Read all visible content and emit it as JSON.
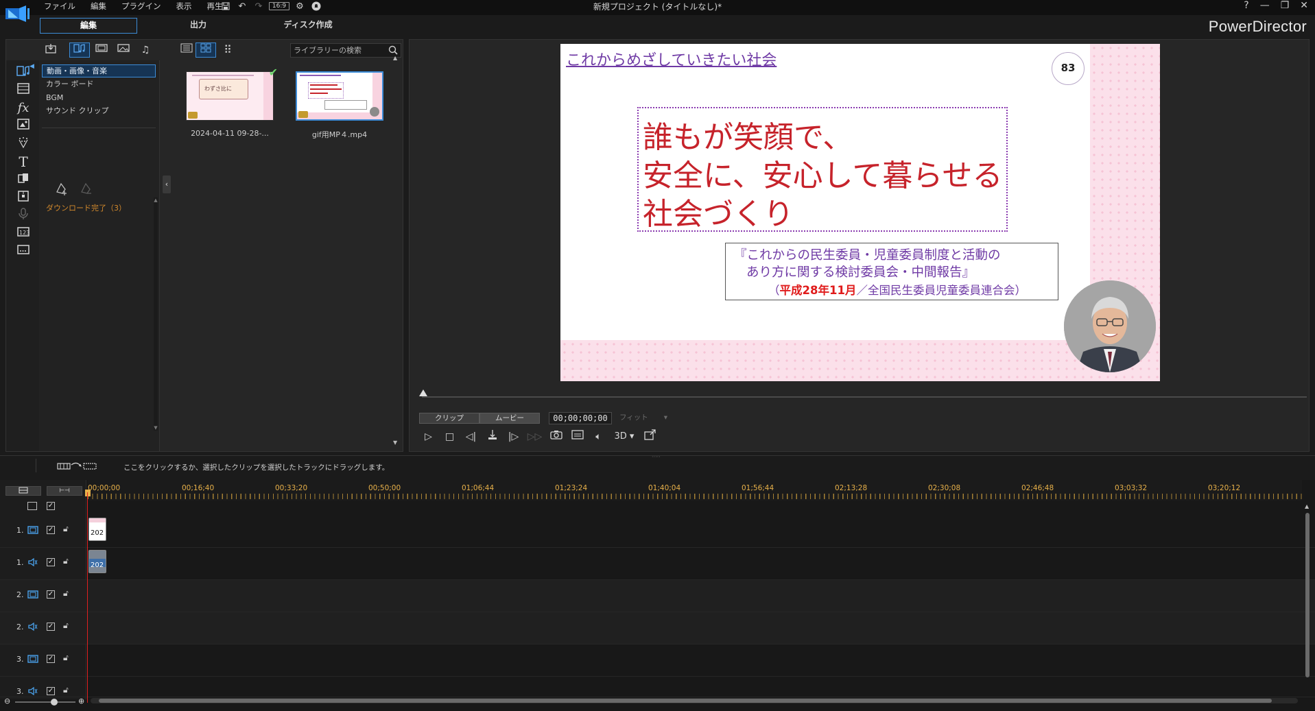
{
  "app": {
    "window_title": "新規プロジェクト (タイトルなし)*",
    "brand": "PowerDirector",
    "menu": [
      "ファイル",
      "編集",
      "プラグイン",
      "表示",
      "再生"
    ],
    "aspect_ratio": "16:9",
    "mode_tabs": [
      "編集",
      "出力",
      "ディスク作成"
    ],
    "window_controls": [
      "?",
      "—",
      "❐",
      "✕"
    ]
  },
  "library": {
    "search_placeholder": "ライブラリーの検索",
    "tree": [
      "動画・画像・音楽",
      "カラー ボード",
      "BGM",
      "サウンド クリップ"
    ],
    "download_done": "ダウンロード完了（3）",
    "media": [
      {
        "label": "2024-04-11 09-28-...",
        "thumb_text": "わずさ比に"
      },
      {
        "label": "gif用MP４.mp4"
      }
    ]
  },
  "preview": {
    "slide": {
      "heading": "これからめざしていきたい社会",
      "number": "83",
      "main_lines": [
        "誰もが笑顔で、",
        "安全に、安心して暮らせる",
        "社会づくり"
      ],
      "quote_line1": "『これからの民生委員・児童委員制度と活動の",
      "quote_line2": "あり方に関する検討委員会・中間報告』",
      "quote_line3_pre": "（",
      "quote_line3_red": "平成28年11月",
      "quote_line3_post": "／全国民生委員児童委員連合会）"
    },
    "mode_clip": "クリップ",
    "mode_movie": "ムービー",
    "timecode": "00;00;00;00",
    "fit": "フィット",
    "threed": "3D"
  },
  "timeline": {
    "hint": "ここをクリックするか、選択したクリップを選択したトラックにドラッグします。",
    "ruler_labels": [
      "00;00;00",
      "00;16;40",
      "00;33;20",
      "00;50;00",
      "01;06;44",
      "01;23;24",
      "01;40;04",
      "01;56;44",
      "02;13;28",
      "02;30;08",
      "02;46;48",
      "03;03;32",
      "03;20;12"
    ],
    "tracks": [
      {
        "num": "1.",
        "type": "video"
      },
      {
        "num": "1.",
        "type": "audio"
      },
      {
        "num": "2.",
        "type": "video"
      },
      {
        "num": "2.",
        "type": "audio"
      },
      {
        "num": "3.",
        "type": "video"
      },
      {
        "num": "3.",
        "type": "audio"
      }
    ],
    "clip_video_label": "202",
    "clip_audio_label": "202"
  },
  "colors": {
    "accent": "#3c8cd8",
    "ruler_text": "#e8b14a",
    "playhead": "#e02020",
    "slide_red": "#c6232b",
    "slide_purple": "#6f3aa5"
  }
}
